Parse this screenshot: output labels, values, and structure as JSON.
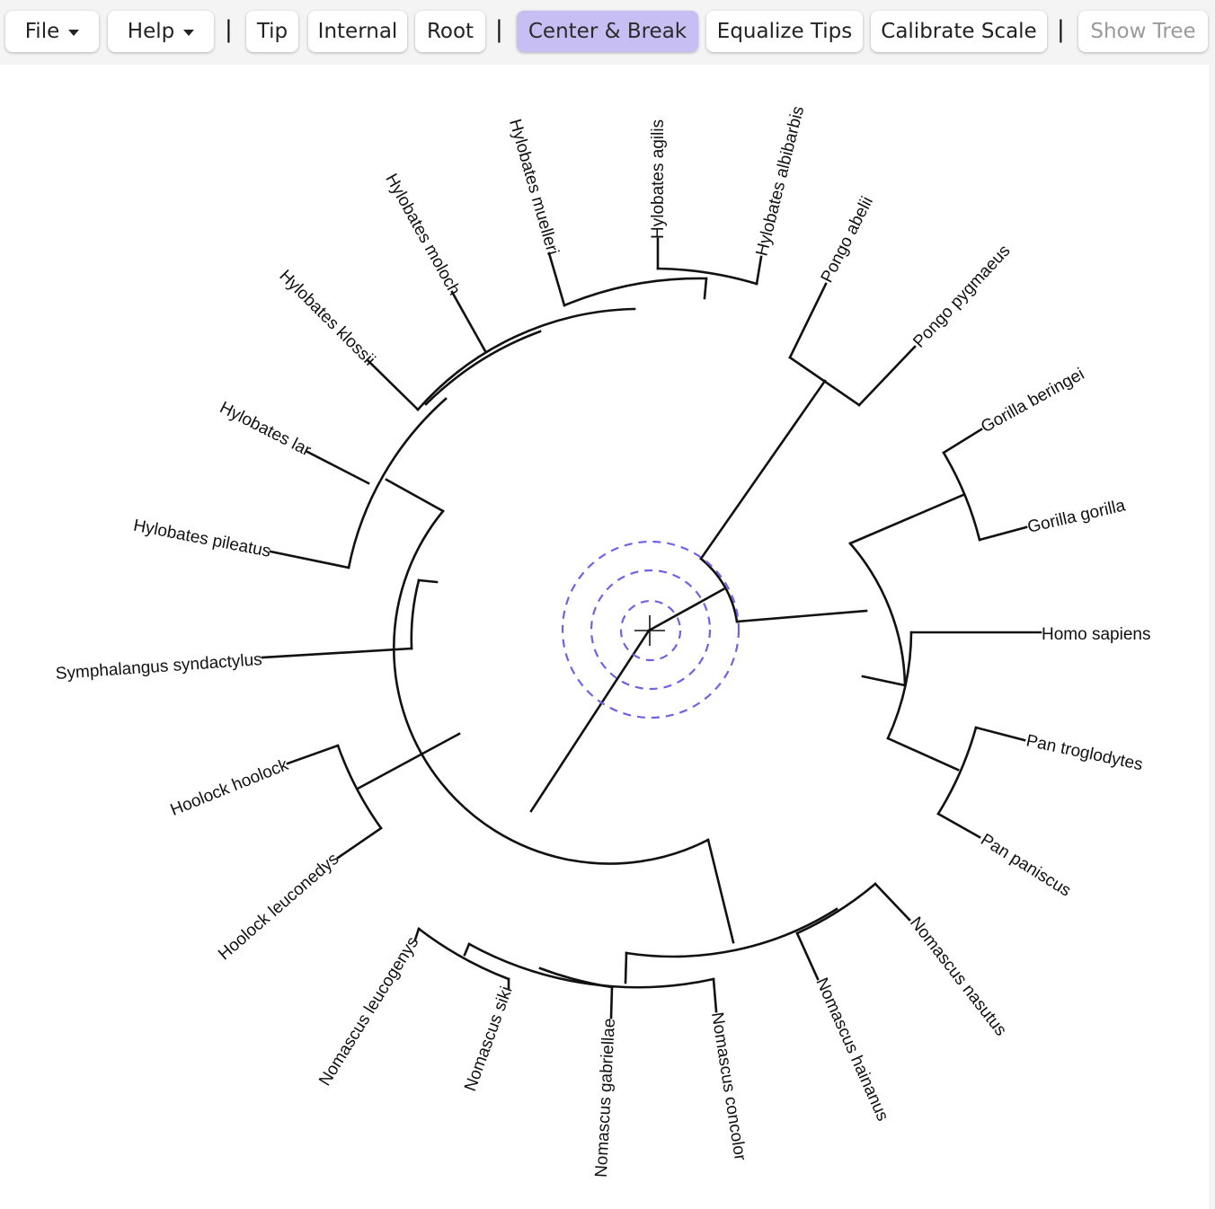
{
  "toolbar": {
    "file_label": "File",
    "help_label": "Help",
    "separator": "|",
    "tip_label": "Tip",
    "internal_label": "Internal",
    "root_label": "Root",
    "center_break_label": "Center & Break",
    "equalize_tips_label": "Equalize Tips",
    "calibrate_scale_label": "Calibrate Scale",
    "show_tree_label": "Show Tree"
  },
  "colors": {
    "active_button": "#c7bff3",
    "cursor_ring": "#6e63e4",
    "branch": "#111111"
  },
  "tree": {
    "layout": "circular",
    "taxa": [
      "Homo sapiens",
      "Pan troglodytes",
      "Pan paniscus",
      "Nomascus nasutus",
      "Nomascus hainanus",
      "Nomascus concolor",
      "Nomascus gabriellae",
      "Nomascus siki",
      "Nomascus leucogenys",
      "Hoolock leuconedys",
      "Hoolock hoolock",
      "Symphalangus syndactylus",
      "Hylobates pileatus",
      "Hylobates lar",
      "Hylobates klossii",
      "Hylobates moloch",
      "Hylobates muelleri",
      "Hylobates agilis",
      "Hylobates albibarbis",
      "Pongo abelii",
      "Pongo pygmaeus",
      "Gorilla beringei",
      "Gorilla gorilla"
    ]
  },
  "cursor": {
    "icon": "crosshair-icon"
  }
}
